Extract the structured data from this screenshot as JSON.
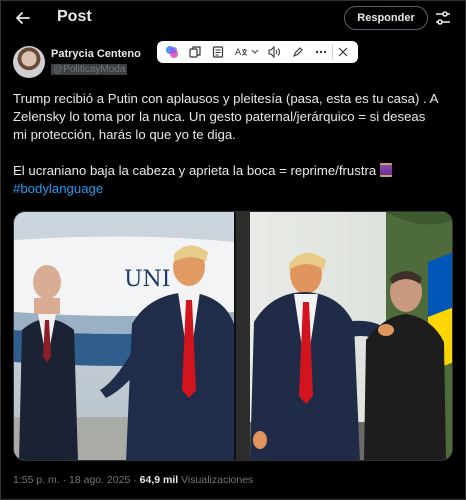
{
  "header": {
    "title": "Post",
    "reply_label": "Responder"
  },
  "post": {
    "author_name": "Patrycia Centeno",
    "author_handle": "@PoliticayModa",
    "text_line1": "Trump recibió a Putin con aplausos y pleitesía (pasa, esta es tu casa) . A",
    "text_line2": "Zelensky lo toma por la nuca. Un gesto paternal/jerárquico = si deseas",
    "text_line3": "mi protección, harás lo que yo te diga.",
    "text_line4": "El ucraniano baja la cabeza y aprieta la boca = reprime/frustra",
    "hashtag": "#bodylanguage",
    "time": "1:55 p. m. · 18 ago. 2025 · ",
    "views_count": "64,9 mil",
    "views_label": " Visualizaciones"
  },
  "toolbar_icons": [
    "copilot-icon",
    "copy-icon",
    "note-icon",
    "translate-icon",
    "chevron-down-icon",
    "speaker-icon",
    "highlight-icon",
    "more-icon",
    "close-icon"
  ],
  "media": {
    "left_plane_text": "UNI",
    "right_flag_colors": [
      "#0057b7",
      "#ffd700"
    ]
  }
}
